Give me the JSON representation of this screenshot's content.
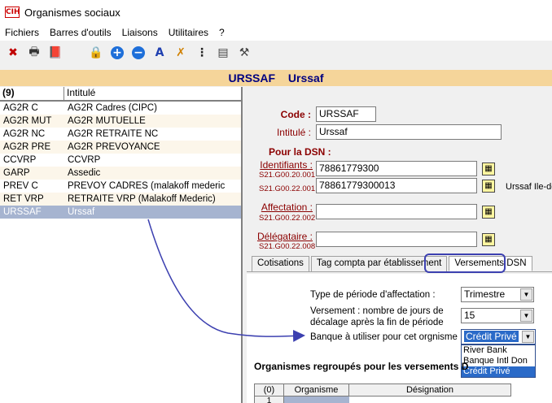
{
  "window": {
    "title": "Organismes sociaux",
    "app_icon_text": "CIH"
  },
  "menu": [
    "Fichiers",
    "Barres d'outils",
    "Liaisons",
    "Utilitaires",
    "?"
  ],
  "toolbar": {
    "icons": [
      "close-icon",
      "print-icon",
      "book-icon",
      "lock-icon",
      "add-icon",
      "remove-icon",
      "font-icon",
      "check-icon",
      "tree-icon",
      "stack-icon",
      "tools-icon"
    ],
    "glyphs": [
      "✖",
      "🖶",
      "📕",
      "🔒",
      "+",
      "−",
      "A",
      "✗",
      "⋮",
      "▤",
      "⚒"
    ]
  },
  "header": {
    "code": "URSSAF",
    "name": "Urssaf"
  },
  "list": {
    "count_label": "(9)",
    "col2_label": "Intitulé",
    "rows": [
      {
        "code": "AG2R C",
        "label": "AG2R Cadres (CIPC)"
      },
      {
        "code": "AG2R MUT",
        "label": "AG2R MUTUELLE"
      },
      {
        "code": "AG2R NC",
        "label": "AG2R RETRAITE NC"
      },
      {
        "code": "AG2R PRE",
        "label": "AG2R PREVOYANCE"
      },
      {
        "code": "CCVRP",
        "label": "CCVRP"
      },
      {
        "code": "GARP",
        "label": "Assedic"
      },
      {
        "code": "PREV C",
        "label": "PREVOY CADRES (malakoff mederic"
      },
      {
        "code": "RET VRP",
        "label": "RETRAITE VRP (Malakoff Mederic)"
      },
      {
        "code": "URSSAF",
        "label": "Urssaf"
      }
    ]
  },
  "detail": {
    "code_label": "Code :",
    "code_value": "URSSAF",
    "intitule_label": "Intitulé :",
    "intitule_value": "Urssaf",
    "dsn_title": "Pour la DSN :",
    "identifiants_label": "Identifiants :",
    "id_code1": "S21.G00.20.001",
    "id_code2": "S21.G00.22.001",
    "id_value1": "78861779300",
    "id_value2": "78861779300013",
    "id_side_text": "Urssaf Ile-de",
    "affectation_label": "Affectation :",
    "affectation_code": "S21.G00.22.002",
    "affectation_value": "",
    "delegataire_label": "Délégataire :",
    "delegataire_code": "S21.G00.22.008",
    "delegataire_value": ""
  },
  "tabs": [
    "Cotisations",
    "Tag compta par établissement",
    "Versements DSN"
  ],
  "versements": {
    "type_label": "Type de période d'affectation :",
    "type_value": "Trimestre",
    "jours_label_1": "Versement : nombre de jours de",
    "jours_label_2": "décalage après la fin de période",
    "jours_value": "15",
    "banque_label": "Banque à utiliser pour cet orgnisme",
    "banque_value": "Crédit Privé",
    "banque_options": [
      "River Bank",
      "Banque Intl Don",
      "Crédit Privé"
    ],
    "section_title": "Organismes regroupés pour les versements D",
    "grid_headers": [
      "(0)",
      "Organisme",
      "Désignation"
    ],
    "grid_first_row": "1"
  },
  "colors": {
    "header_band": "#f5d59a",
    "selected_row": "#a6b4d0",
    "annotation": "#3c40b0",
    "label_red": "#8b0000"
  }
}
